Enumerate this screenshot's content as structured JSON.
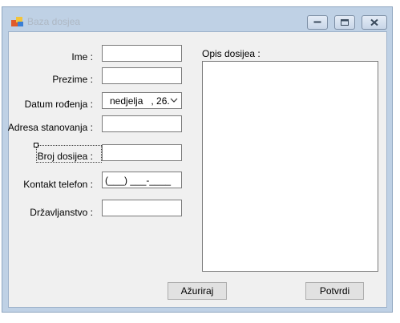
{
  "window": {
    "title": "Baza dosjea",
    "controls": {
      "minimize": "minimize-icon",
      "maximize": "maximize-icon",
      "close": "close-icon"
    }
  },
  "form": {
    "ime_label": "Ime :",
    "prezime_label": "Prezime :",
    "datum_label": "Datum rođenja :",
    "datum_value": "nedjelja   , 26.",
    "adresa_label": "Adresa stanovanja :",
    "broj_label": "Broj dosijea :",
    "kontakt_label": "Kontakt telefon :",
    "kontakt_mask": "(___) ___-____",
    "drzavljanstvo_label": "Državljanstvo :",
    "opis_label": "Opis dosijea :",
    "ime_value": "",
    "prezime_value": "",
    "adresa_value": "",
    "broj_value": "",
    "drzavljanstvo_value": ""
  },
  "buttons": {
    "azuriraj": "Ažuriraj",
    "potvrdi": "Potvrdi"
  },
  "colors": {
    "frame": "#bfd1e5",
    "client": "#f0f0f0",
    "button": "#e1e1e1"
  }
}
